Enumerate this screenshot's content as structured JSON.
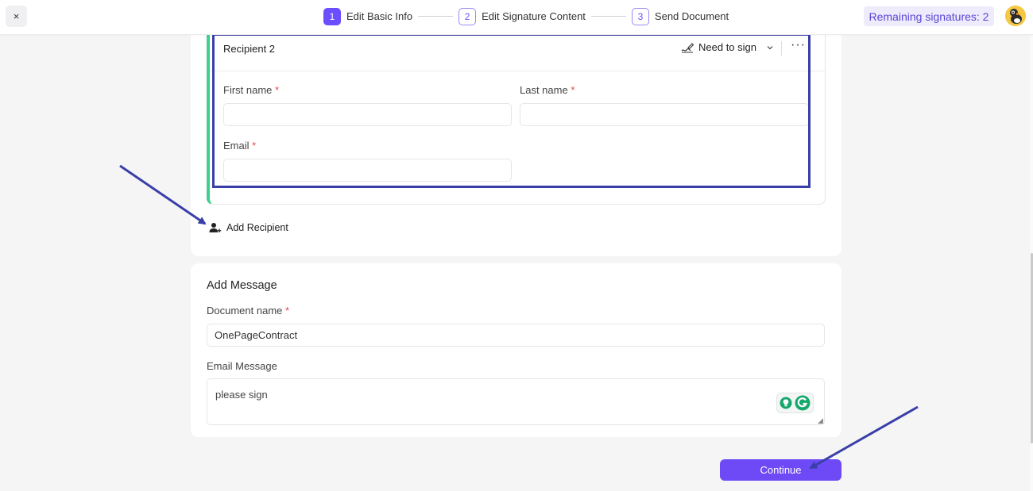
{
  "header": {
    "close_glyph": "×",
    "steps": [
      {
        "num": "1",
        "label": "Edit Basic Info"
      },
      {
        "num": "2",
        "label": "Edit Signature Content"
      },
      {
        "num": "3",
        "label": "Send Document"
      }
    ],
    "remaining": "Remaining signatures: 2"
  },
  "recipient": {
    "title": "Recipient 2",
    "role": "Need to sign",
    "more": "···",
    "first_name_label": "First name",
    "last_name_label": "Last name",
    "email_label": "Email",
    "required_mark": "*",
    "first_name_value": "",
    "last_name_value": "",
    "email_value": ""
  },
  "add_recipient_label": "Add Recipient",
  "message": {
    "title": "Add Message",
    "doc_name_label": "Document name",
    "doc_name_value": "OnePageContract",
    "email_message_label": "Email Message",
    "email_message_value": "please sign"
  },
  "continue_label": "Continue",
  "colors": {
    "accent": "#6e4af6",
    "highlight": "#3a3fa8",
    "recipient_bar": "#3fcf8e",
    "required": "#e5484d"
  }
}
